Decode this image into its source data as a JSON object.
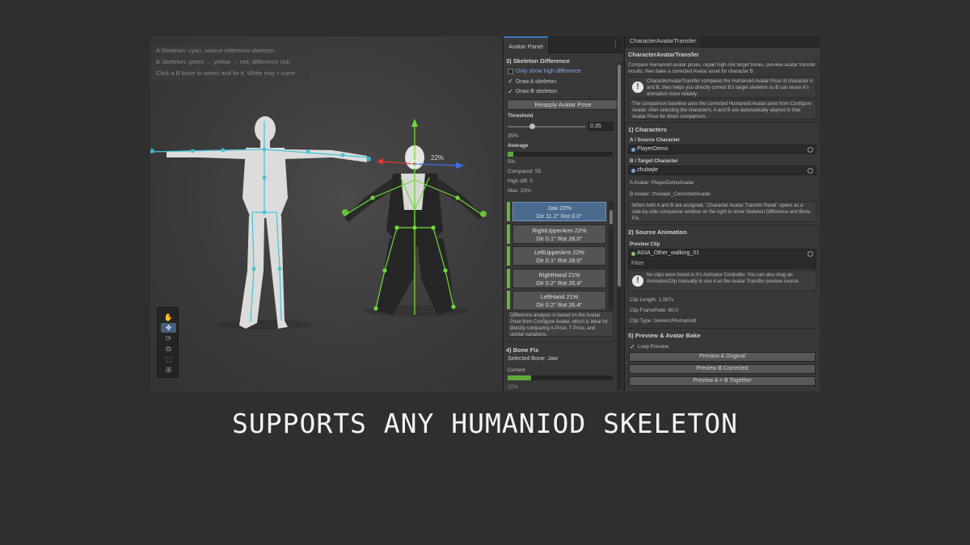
{
  "scene": {
    "info_lines": [
      "A Skeleton: cyan, source reference skeleton",
      "B Skeleton: green → yellow → red, difference risk",
      "Click a B bone to select and fix it. White ring = curre"
    ],
    "gizmo_label": "22%",
    "tools": [
      "hand-tool",
      "move-tool",
      "rotate-tool",
      "scale-tool",
      "rect-tool",
      "transform-tool"
    ]
  },
  "avatar_panel": {
    "tab_label": "Avatar Panel",
    "menu_glyph": "⋮",
    "section_title": "3) Skeleton Difference",
    "only_high_label": "Only show high-difference",
    "draw_a_label": "Draw A skeleton",
    "draw_b_label": "Draw B skeleton",
    "reapply_label": "Reapply Avatar Pose",
    "threshold_label": "Threshold",
    "threshold_value": "0.35",
    "threshold_pct": "35%",
    "average_label": "Average",
    "average_pct": "5%",
    "average_fill": 0.05,
    "compared": "Compared: 55",
    "high_diff": "High diff: 0",
    "max": "Max: 22%",
    "bones": [
      {
        "line1": "Jaw  22%",
        "line2": "Dir 11.2°  Rot 0.0°",
        "selected": true
      },
      {
        "line1": "RightUpperArm  22%",
        "line2": "Dir 0.1°  Rot 28.0°",
        "selected": false
      },
      {
        "line1": "LeftUpperArm  22%",
        "line2": "Dir 0.1°  Rot 28.0°",
        "selected": false
      },
      {
        "line1": "RightHand  21%",
        "line2": "Dir 0.2°  Rot 26.4°",
        "selected": false
      },
      {
        "line1": "LeftHand  21%",
        "line2": "Dir 0.2°  Rot 26.4°",
        "selected": false
      }
    ],
    "help_text": "Difference analysis is based on the Avatar Pose from Configure Avatar, which is ideal for directly comparing A-Pose, T-Pose, and similar variations.",
    "bone_fix_title": "4) Bone Fix",
    "selected_bone": "Selected Bone: Jaw",
    "current_label": "Current",
    "current_pct": "22%",
    "current_fill": 0.22
  },
  "transfer_panel": {
    "tab_label": "CharacterAvatarTransfer",
    "title": "CharacterAvatarTransfer",
    "intro": "Compare Humanoid avatar poses, repair high-risk target bones, preview avatar transfer results, then bake a corrected Avatar asset for character B.",
    "info_box": "CharacterAvatarTransfer compares the Humanoid Avatar Pose of character A and B, then helps you directly correct B's target skeleton so B can reuse A's animation more reliably.",
    "baseline_note": "The comparison baseline uses the corrected Humanoid Avatar pose from Configure Avatar. After selecting the characters, A and B are automatically aligned to that Avatar Pose for direct comparison.",
    "characters_title": "1) Characters",
    "a_label": "A / Source Character",
    "a_value": "PlayerDemo",
    "b_label": "B / Target Character",
    "b_value": "zhubajie",
    "a_avatar": "A Avatar: PlayerDemoAvatar",
    "b_avatar": "B Avatar: zhubajie_CorrectedAvatar",
    "assigned_note": "When both A and B are assigned, `Character Avatar Transfer Panel` opens as a side-by-side companion window on the right to show Skeleton Difference and Bone Fix.",
    "anim_title": "2) Source Animation",
    "preview_clip_label": "Preview Clip",
    "clip_value": "AGIA_Other_walking_01",
    "filter_placeholder": "Filter",
    "clips_note": "No clips were found in A's Animator Controller. You can also drag an AnimationClip manually to use it as the Avatar Transfer preview source.",
    "clip_length": "Clip Length: 1.067s",
    "clip_framerate": "Clip FrameRate: 60.0",
    "clip_type": "Clip Type: Generic/Humanoid",
    "bake_title": "5) Preview & Avatar Bake",
    "loop_label": "Loop Preview",
    "preview_a": "Preview A Original",
    "preview_b": "Preview B Corrected",
    "preview_ab": "Preview A + B Together"
  },
  "caption": "SUPPORTS ANY HUMANIOD SKELETON",
  "colors": {
    "skeleton_a": "#3fc4d8",
    "skeleton_b": "#6fdc3a",
    "accent": "#3a79bb",
    "selected_bone": "#4a6a8e"
  }
}
